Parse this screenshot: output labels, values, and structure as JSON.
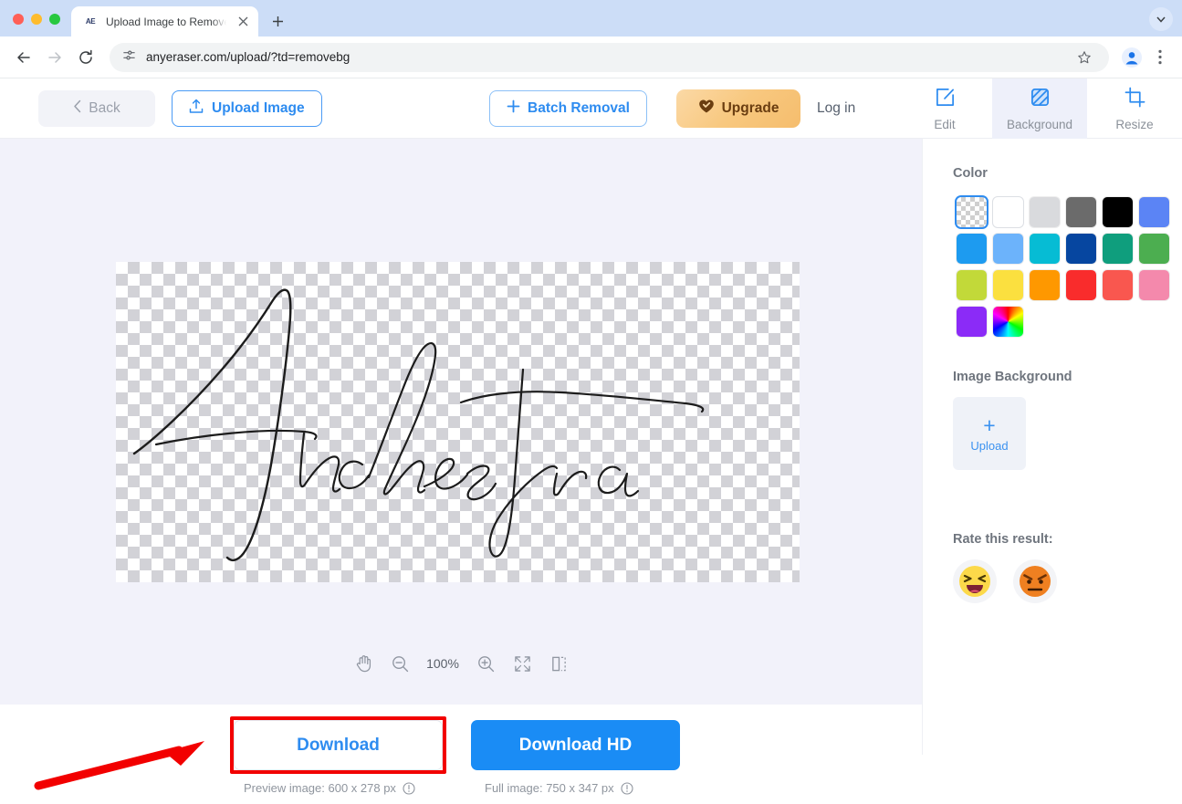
{
  "browser": {
    "tab": {
      "title": "Upload Image to Remove Bg",
      "favicon_label": "AE",
      "favicon_name": "anyeraser-favicon"
    },
    "new_tab_label": "+",
    "tabstrip_chevron": "tabstrip-chevron-icon",
    "url": "anyeraser.com/upload/?td=removebg",
    "back_icon": "back-arrow-icon",
    "forward_icon": "forward-arrow-icon",
    "reload_icon": "reload-icon",
    "site_info_icon": "site-settings-icon",
    "bookmark_icon": "star-icon",
    "profile_icon": "profile-avatar-icon",
    "menu_icon": "three-dot-menu-icon"
  },
  "toolbar": {
    "back_label": "Back",
    "upload_label": "Upload Image",
    "batch_label": "Batch Removal",
    "upgrade_label": "Upgrade",
    "login_label": "Log in",
    "tabs": [
      {
        "label": "Edit",
        "icon": "edit-pencil-icon",
        "active": false
      },
      {
        "label": "Background",
        "icon": "background-hatch-icon",
        "active": true
      },
      {
        "label": "Resize",
        "icon": "crop-icon",
        "active": false
      }
    ]
  },
  "canvas": {
    "signature_text": "Anchestra",
    "zoom_level": "100%",
    "tools": [
      {
        "name": "pan-hand-tool",
        "label": "Pan"
      },
      {
        "name": "zoom-out-button",
        "label": "Zoom out"
      },
      {
        "name": "zoom-level-display",
        "label": "100%"
      },
      {
        "name": "zoom-in-button",
        "label": "Zoom in"
      },
      {
        "name": "fit-screen-button",
        "label": "Fit to screen"
      },
      {
        "name": "compare-split-button",
        "label": "Compare"
      }
    ]
  },
  "download": {
    "download_label": "Download",
    "download_hd_label": "Download HD",
    "preview_caption": "Preview image: 600 x 278 px",
    "full_caption": "Full image: 750 x 347 px",
    "highlight_color": "#f20000",
    "annotation_arrow": "red-pointer-arrow"
  },
  "sidebar": {
    "color_heading": "Color",
    "image_background_heading": "Image Background",
    "upload_plus": "+",
    "upload_label": "Upload",
    "rate_heading": "Rate this result:",
    "rate_options": [
      {
        "name": "rate-happy-button",
        "emoji": "😆"
      },
      {
        "name": "rate-angry-button",
        "emoji": "😠"
      }
    ],
    "swatches": [
      {
        "name": "transparent",
        "color": "transparent",
        "selected": true
      },
      {
        "name": "white",
        "color": "#ffffff",
        "selected": false
      },
      {
        "name": "light-gray",
        "color": "#d9dadd",
        "selected": false
      },
      {
        "name": "dark-gray",
        "color": "#6b6b6b",
        "selected": false
      },
      {
        "name": "black",
        "color": "#000000",
        "selected": false
      },
      {
        "name": "cornflower-blue",
        "color": "#5b84f5",
        "selected": false
      },
      {
        "name": "azure-blue",
        "color": "#1d9bf0",
        "selected": false
      },
      {
        "name": "sky-blue",
        "color": "#6cb3fb",
        "selected": false
      },
      {
        "name": "cyan",
        "color": "#06bcd4",
        "selected": false
      },
      {
        "name": "navy-blue",
        "color": "#0646a0",
        "selected": false
      },
      {
        "name": "teal-green",
        "color": "#0f9e7d",
        "selected": false
      },
      {
        "name": "green",
        "color": "#4cae50",
        "selected": false
      },
      {
        "name": "lime-green",
        "color": "#c2d939",
        "selected": false
      },
      {
        "name": "yellow",
        "color": "#fbe03f",
        "selected": false
      },
      {
        "name": "orange",
        "color": "#fe9800",
        "selected": false
      },
      {
        "name": "red",
        "color": "#f92c2c",
        "selected": false
      },
      {
        "name": "coral-red",
        "color": "#f9574f",
        "selected": false
      },
      {
        "name": "pink",
        "color": "#f489ac",
        "selected": false
      },
      {
        "name": "purple",
        "color": "#8b2bf7",
        "selected": false
      },
      {
        "name": "rainbow-picker",
        "color": "rainbow",
        "selected": false
      }
    ]
  }
}
